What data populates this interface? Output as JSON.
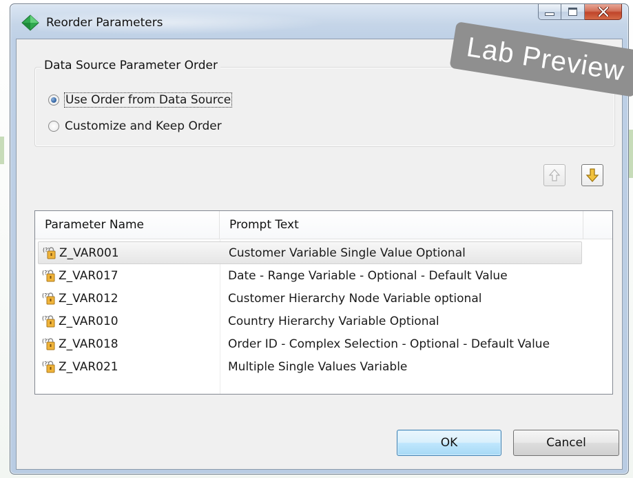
{
  "window": {
    "title": "Reorder Parameters",
    "controls": [
      "minimize-icon",
      "maximize-icon",
      "close-icon"
    ]
  },
  "group": {
    "title": "Data Source Parameter Order",
    "options": [
      {
        "label": "Use Order from Data Source",
        "selected": true
      },
      {
        "label": "Customize and Keep Order",
        "selected": false
      }
    ]
  },
  "move_buttons": {
    "up_icon": "arrow-up-icon",
    "down_icon": "arrow-down-icon",
    "up_enabled": false
  },
  "table": {
    "columns": [
      "Parameter Name",
      "Prompt Text"
    ],
    "selected_index": 0,
    "rows": [
      {
        "name": "Z_VAR001",
        "prompt": "Customer Variable Single Value Optional"
      },
      {
        "name": "Z_VAR017",
        "prompt": "Date - Range Variable - Optional - Default Value"
      },
      {
        "name": "Z_VAR012",
        "prompt": "Customer Hierarchy Node Variable optional"
      },
      {
        "name": "Z_VAR010",
        "prompt": "Country Hierarchy Variable Optional"
      },
      {
        "name": "Z_VAR018",
        "prompt": "Order ID - Complex Selection - Optional - Default Value"
      },
      {
        "name": "Z_VAR021",
        "prompt": "Multiple Single Values Variable"
      }
    ]
  },
  "buttons": {
    "ok": "OK",
    "cancel": "Cancel"
  },
  "watermark": "Lab Preview",
  "colors": {
    "accent": "#3c7fb1",
    "window_frame": "#b9cce3",
    "close_button": "#c0452a",
    "arrow_down": "#f2c23c"
  }
}
